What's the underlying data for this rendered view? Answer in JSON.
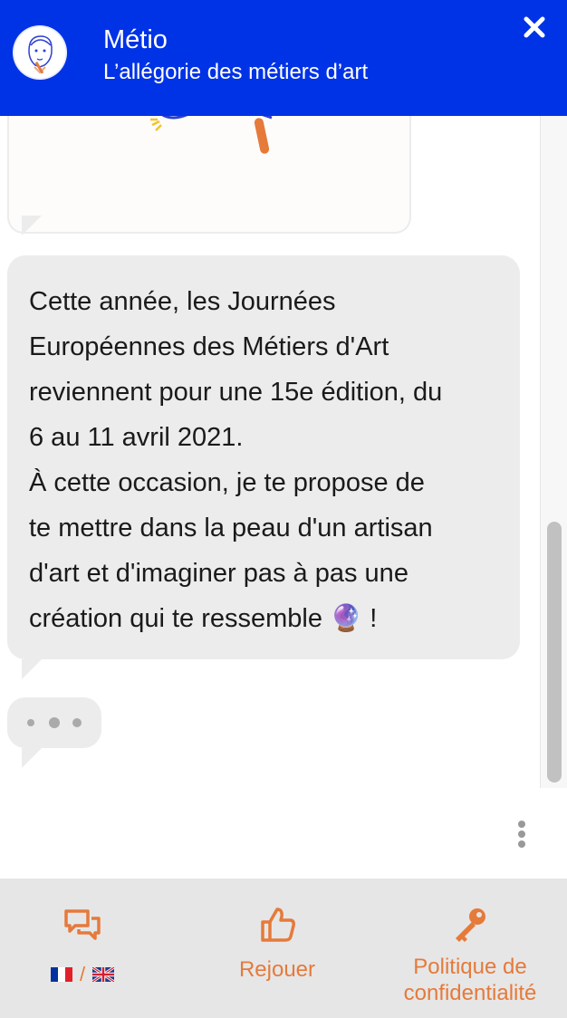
{
  "header": {
    "title": "Métio",
    "subtitle": "L’allégorie des métiers d’art",
    "close_icon": "close-icon",
    "bg_color": "#0033e6"
  },
  "chat": {
    "message_text": "Cette année, les Journées\nEuropéennes des Métiers d'Art\nreviennent pour une 15e édition, du\n6 au 11 avril 2021.\nÀ cette occasion, je te propose de\nte mettre dans la peau d'un artisan\nd'art et d'imaginer pas à pas une\ncréation qui te ressemble 🔮 !"
  },
  "footer": {
    "language": {
      "icon": "chat-bubbles-icon",
      "separator": "/",
      "flags": [
        "fr-flag",
        "uk-flag"
      ]
    },
    "replay": {
      "icon": "thumbs-up-icon",
      "label": "Rejouer"
    },
    "privacy": {
      "icon": "key-icon",
      "label_line1": "Politique de",
      "label_line2": "confidentialité"
    },
    "accent_color": "#e57a3b"
  }
}
